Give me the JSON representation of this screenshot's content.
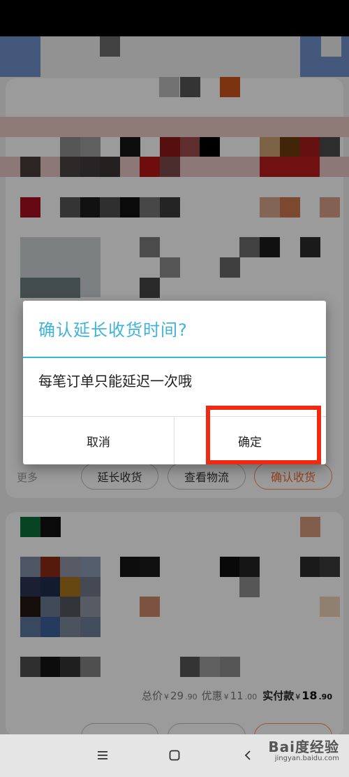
{
  "dialog": {
    "title": "确认延长收货时间?",
    "message": "每笔订单只能延迟一次哦",
    "cancel_label": "取消",
    "confirm_label": "确定"
  },
  "background_order_1": {
    "more_label": "更多",
    "extend_label": "延长收货",
    "logistics_label": "查看物流",
    "confirm_receipt_label": "确认收货"
  },
  "background_order_2": {
    "total_label": "总价",
    "total_currency": "¥",
    "total_int": "29",
    "total_dec": ".90",
    "discount_label": "优惠",
    "discount_currency": "¥",
    "discount_int": "11",
    "discount_dec": ".00",
    "paid_label": "实付款",
    "paid_currency": "¥",
    "paid_int": "18",
    "paid_dec": ".90"
  },
  "watermark": {
    "brand": "Bai度经验",
    "url": "jingyan.baidu.com"
  },
  "nav_icons": [
    "menu-icon",
    "home-icon",
    "back-icon"
  ],
  "colors": {
    "title_blue": "#3fb3d9",
    "highlight_red": "#ee2a12",
    "accent_orange": "#ef6a2f"
  }
}
